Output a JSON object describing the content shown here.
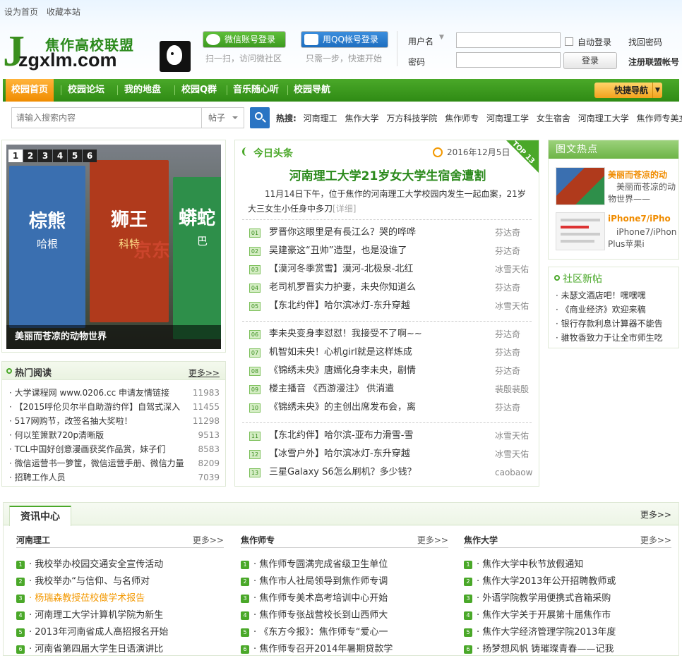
{
  "top_links": [
    "设为首页",
    "收藏本站"
  ],
  "logo": {
    "name": "焦作高校联盟",
    "domain": "zgxlm.com"
  },
  "social": {
    "wechat_label": "微信账号登录",
    "wechat_sub": "扫一扫，访问微社区",
    "qq_label": "用QQ帐号登录",
    "qq_sub": "只需一步，快速开始"
  },
  "login": {
    "username_label": "用户名",
    "password_label": "密码",
    "auto_login": "自动登录",
    "login_button": "登录",
    "find_password": "找回密码",
    "register": "注册联盟帐号"
  },
  "nav": {
    "items": [
      "校园首页",
      "校园论坛",
      "我的地盘",
      "校园Q群",
      "音乐随心听",
      "校园导航"
    ],
    "quick_nav": "快捷导航"
  },
  "search": {
    "placeholder": "请输入搜索内容",
    "scope": "帖子"
  },
  "hot_keywords": {
    "label": "热搜:",
    "items": [
      "河南理工",
      "焦作大学",
      "万方科技学院",
      "焦作师专",
      "河南理工学",
      "女生宿舍",
      "河南理工大学",
      "焦作师专美女"
    ]
  },
  "slider": {
    "pages": [
      "1",
      "2",
      "3",
      "4",
      "5",
      "6"
    ],
    "caption": "美丽而苍凉的动物世界",
    "books": [
      {
        "title": "棕熊",
        "subtitle": "哈根"
      },
      {
        "title": "狮王",
        "subtitle": "科特"
      },
      {
        "title": "蟒蛇",
        "subtitle": "巴"
      }
    ],
    "watermark": "京东"
  },
  "hot_reading": {
    "title": "热门阅读",
    "more": "更多>>",
    "items": [
      {
        "title": "大学课程网 www.0206.cc 申请友情链接",
        "count": "11983"
      },
      {
        "title": "【2015呼伦贝尔半自助游约伴】自驾式深入",
        "count": "11455"
      },
      {
        "title": "517网购节，改签名抽大奖啦！",
        "count": "11298"
      },
      {
        "title": "何以笙箫默720p清晰版",
        "count": "9513"
      },
      {
        "title": "TCL中国好创意漫画获奖作品赏，妹子们",
        "count": "8583"
      },
      {
        "title": "微信运营书一箩筐，微信运营手册、微信力量",
        "count": "8209"
      },
      {
        "title": "招聘工作人员",
        "count": "7039"
      }
    ]
  },
  "headline": {
    "section": "今日头条",
    "date": "2016年12月5日",
    "badge": "TOP 13",
    "title": "河南理工大学21岁女大学生宿舍遭割",
    "summary": "11月14日下午，位于焦作的河南理工大学校园内发生一起血案，21岁大三女生小任身中多刀",
    "summary_more": "[详细]"
  },
  "news_groups": [
    [
      {
        "num": "01",
        "title": "罗晋你这眼里是有長江么？哭的哗哗",
        "author": "芬达奇"
      },
      {
        "num": "02",
        "title": "吴建豪这“丑帅”造型，也是没谁了",
        "author": "芬达奇"
      },
      {
        "num": "03",
        "title": "【漠河冬季赏雪】漠河-北极泉-北红",
        "author": "冰雪天佑"
      },
      {
        "num": "04",
        "title": "老司机罗晋实力护妻，未央你知道么",
        "author": "芬达奇"
      },
      {
        "num": "05",
        "title": "【东北约伴】哈尔滨冰灯-东升穿越",
        "author": "冰雪天佑"
      }
    ],
    [
      {
        "num": "06",
        "title": "李未央变身李怼怼！我接受不了啊~~",
        "author": "芬达奇"
      },
      {
        "num": "07",
        "title": "机智如未央！心机girl就是这样炼成",
        "author": "芬达奇"
      },
      {
        "num": "08",
        "title": "《锦绣未央》唐嫣化身李未央，剧情",
        "author": "芬达奇"
      },
      {
        "num": "09",
        "title": "楼主播音 《西游漫注》 供消遣",
        "author": "裴殷裴殷"
      },
      {
        "num": "10",
        "title": "《锦绣未央》的主创出席发布会，离",
        "author": "芬达奇"
      }
    ],
    [
      {
        "num": "11",
        "title": "【东北约伴】哈尔滨-亚布力滑雪-雪",
        "author": "冰雪天佑"
      },
      {
        "num": "12",
        "title": "【冰雪户外】哈尔滨冰灯-东升穿越",
        "author": "冰雪天佑"
      },
      {
        "num": "13",
        "title": "三星Galaxy S6怎么刷机？多少钱？",
        "author": "caobaow"
      }
    ]
  ],
  "pic_text": {
    "title": "图文热点",
    "items": [
      {
        "title": "美丽而苍凉的动",
        "desc": "美丽而苍凉的动物世界——"
      },
      {
        "title": "iPhone7/iPho",
        "desc": "iPhone7/iPhone7 Plus苹果i"
      }
    ]
  },
  "community": {
    "title": "社区新帖",
    "items": [
      "未瑟文酒店吧！嘿嘿嘿",
      "《商业经济》欢迎来稿",
      "银行存款利息计算器不能告",
      "骓牧香致力于让全市师生吃"
    ]
  },
  "info_center": {
    "tab": "资讯中心",
    "more": "更多>>",
    "columns": [
      {
        "title": "河南理工",
        "more": "更多>>",
        "items": [
          "我校举办校园交通安全宣传活动",
          "我校举办“与信仰、与名师对",
          "杨瑞森教授莅校做学术报告",
          "河南理工大学计算机学院为新生",
          "2013年河南省成人高招报名开始",
          "河南省第四届大学生日语演讲比"
        ]
      },
      {
        "title": "焦作师专",
        "more": "更多>>",
        "items": [
          "焦作师专圆满完成省级卫生单位",
          "焦作市人社局领导到焦作师专调",
          "焦作师专美术高考培训中心开始",
          "焦作师专张战营校长到山西师大",
          "《东方今报》：焦作师专“爱心一",
          "焦作师专召开2014年暑期贷款学"
        ]
      },
      {
        "title": "焦作大学",
        "more": "更多>>",
        "items": [
          "焦作大学中秋节放假通知",
          "焦作大学2013年公开招聘教师或",
          "外语学院教学用便携式音箱采购",
          "焦作大学关于开展第十届焦作市",
          "焦作大学经济管理学院2013年度",
          "扬梦想风帆 铸璀璨青春——记我"
        ]
      }
    ]
  },
  "colors": {
    "brand_green": "#3a8f1e",
    "nav_active": "#f39800",
    "link_highlight": "#f39800"
  }
}
